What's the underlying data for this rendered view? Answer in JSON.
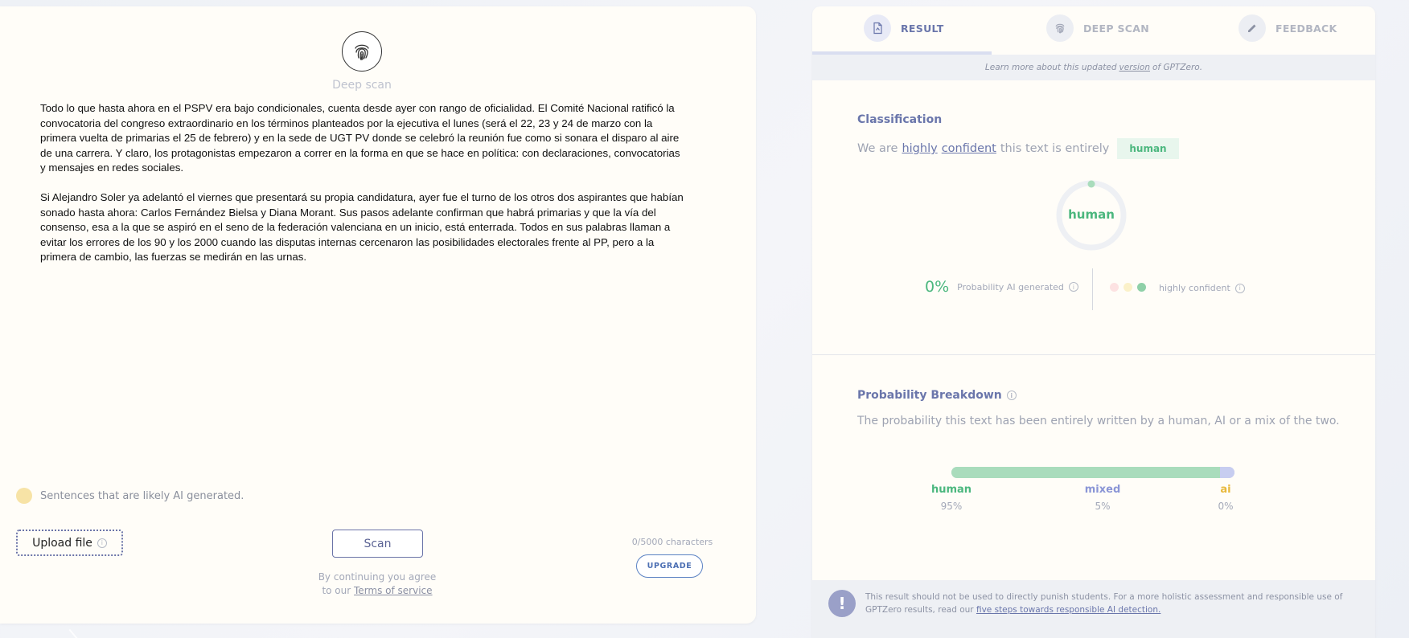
{
  "editor": {
    "deep_scan_label": "Deep scan",
    "paragraphs": [
      "Todo lo que hasta ahora en el PSPV era bajo condicionales, cuenta desde ayer con rango de oficialidad. El Comité Nacional ratificó la convocatoria del congreso extraordinario en los términos planteados por la ejecutiva el lunes (será el 22, 23 y 24 de marzo con la primera vuelta de primarias el 25 de febrero) y en la sede de UGT PV donde se celebró la reunión fue como si sonara el disparo al aire de una carrera. Y claro, los protagonistas empezaron a correr en la forma en que se hace en política: con declaraciones, convocatorias y mensajes en redes sociales.",
      "Si Alejandro Soler ya adelantó el viernes que presentará su propia candidatura, ayer fue el turno de los otros dos aspirantes que habían sonado hasta ahora: Carlos Fernández Bielsa y Diana Morant. Sus pasos adelante confirman que habrá primarias y que la vía del consenso, esa a la que se aspiró en el seno de la federación valenciana en un inicio, está enterrada. Todos en sus palabras llaman a evitar los errores de los 90 y los 2000 cuando las disputas internas cercenaron las posibilidades electorales frente al PP, pero a la primera de cambio, las fuerzas se medirán en las urnas."
    ],
    "legend_text": "Sentences that are likely AI generated.",
    "legend_color": "#f7e3a6",
    "upload_label": "Upload file",
    "scan_label": "Scan",
    "terms_line1": "By continuing you agree",
    "terms_prefix": "to our",
    "terms_link": "Terms of service",
    "char_count": "0/5000 characters",
    "upgrade_label": "UPGRADE"
  },
  "results": {
    "tabs": [
      {
        "label": "RESULT",
        "icon": "document-icon",
        "active": true
      },
      {
        "label": "DEEP SCAN",
        "icon": "fingerprint-icon",
        "active": false
      },
      {
        "label": "FEEDBACK",
        "icon": "pencil-icon",
        "active": false
      }
    ],
    "info_strip": {
      "prefix": "Learn more about this updated",
      "link": "version",
      "suffix": "of GPTZero."
    },
    "classification": {
      "title": "Classification",
      "prefix": "We are",
      "word1": "highly",
      "word2": "confident",
      "middle": "this text is entirely",
      "badge": "human",
      "donut_label": "human",
      "prob_pct": "0%",
      "prob_text": "Probability AI generated",
      "confidence_text": "highly confident",
      "confidence_dots": [
        "#fde2e2",
        "#fbf1c9",
        "#8fd0a8"
      ]
    },
    "breakdown": {
      "title": "Probability Breakdown",
      "description": "The probability this text has been entirely written by a human, AI or a mix of the two.",
      "items": [
        {
          "label": "human",
          "pct": "95%",
          "value": 0.95,
          "color": "#4bb77e"
        },
        {
          "label": "mixed",
          "pct": "5%",
          "value": 0.05,
          "color": "#8b96d6"
        },
        {
          "label": "ai",
          "pct": "0%",
          "value": 0.0,
          "color": "#e8b93c"
        }
      ]
    },
    "footer": {
      "text": "This result should not be used to directly punish students. For a more holistic assessment and responsible use of GPTZero results, read our",
      "link": "five steps towards responsible AI detection."
    }
  }
}
